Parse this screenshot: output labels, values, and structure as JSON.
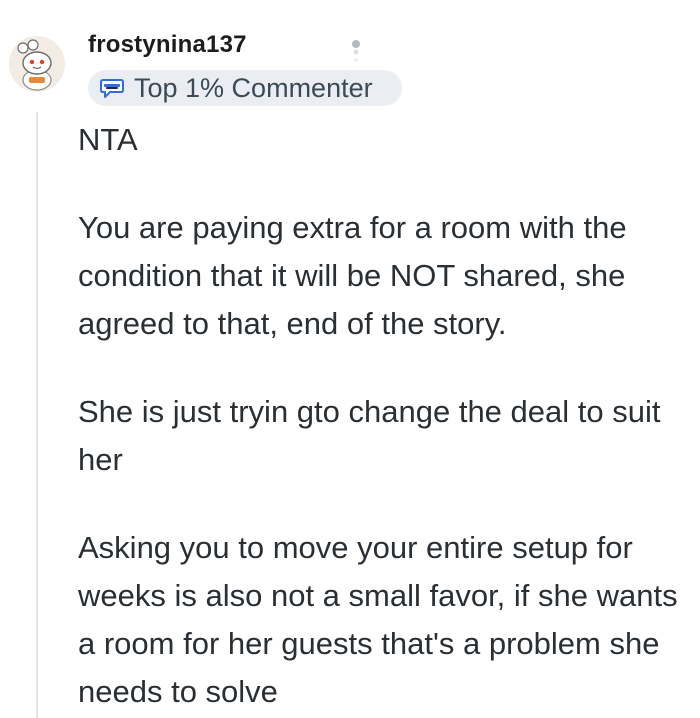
{
  "comment": {
    "author": {
      "username": "frostynina137",
      "avatar": "avatar-snoo-icon",
      "flair": {
        "icon": "commenter-badge-icon",
        "text": "Top 1% Commenter"
      }
    },
    "more_icon": "more-options-icon",
    "paragraphs": [
      "NTA",
      "You are paying extra for a room with the condition that it will be NOT shared, she agreed to that, end of the story.",
      "She is just tryin gto change the deal to suit her",
      "Asking you to move your entire setup for weeks is also not a small favor, if she wants a room for her guests that's a problem she needs to solve"
    ]
  },
  "colors": {
    "text": "#2a2f33",
    "username": "#1c1c1c",
    "flair_background": "#eaeef2",
    "flair_text": "#3b4a57",
    "thread_line": "#e4e7ea",
    "badge_blue": "#2f6fd6"
  }
}
